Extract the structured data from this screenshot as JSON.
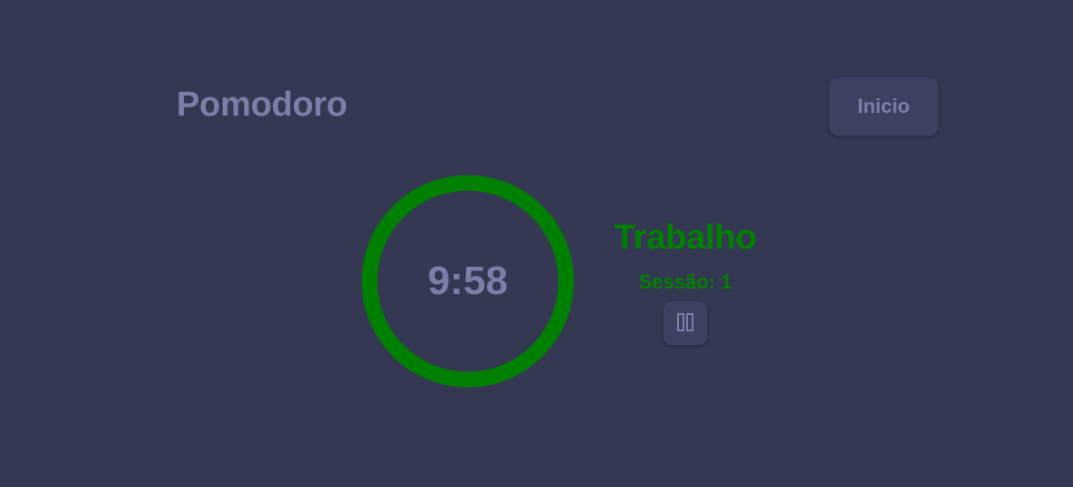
{
  "header": {
    "title": "Pomodoro",
    "home_button_label": "Inicio"
  },
  "timer": {
    "time_display": "9:58",
    "mode": "Trabalho",
    "session_label": "Sessão: 1",
    "pause_icon": "pause-icon"
  },
  "colors": {
    "background": "#343852",
    "text_muted": "#7a7fa8",
    "accent_green": "#008000",
    "button_bg": "#3c4162"
  }
}
